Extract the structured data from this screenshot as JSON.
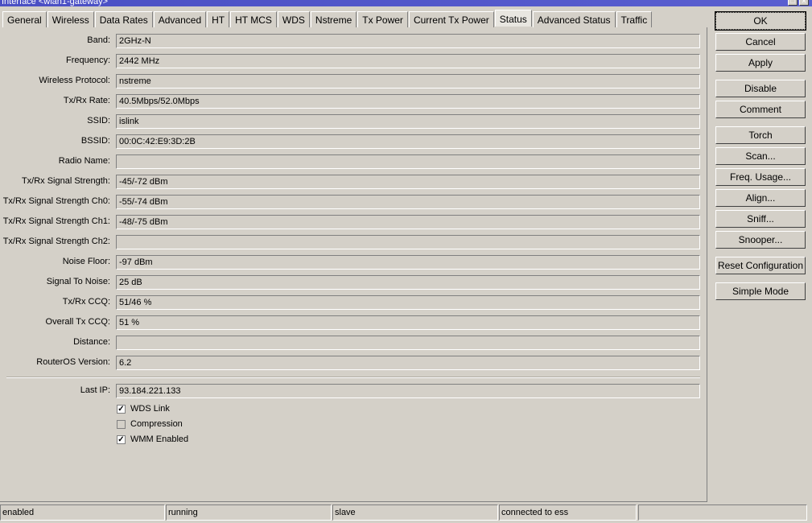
{
  "window": {
    "title": "Interface <wlan1-gateway>",
    "restore": "□",
    "close": "✕"
  },
  "tabs": [
    "General",
    "Wireless",
    "Data Rates",
    "Advanced",
    "HT",
    "HT MCS",
    "WDS",
    "Nstreme",
    "Tx Power",
    "Current Tx Power",
    "Status",
    "Advanced Status",
    "Traffic"
  ],
  "active_tab": "Status",
  "fields": [
    {
      "label": "Band:",
      "value": "2GHz-N"
    },
    {
      "label": "Frequency:",
      "value": "2442 MHz"
    },
    {
      "label": "Wireless Protocol:",
      "value": "nstreme"
    },
    {
      "label": "Tx/Rx Rate:",
      "value": "40.5Mbps/52.0Mbps"
    },
    {
      "label": "SSID:",
      "value": "islink"
    },
    {
      "label": "BSSID:",
      "value": "00:0C:42:E9:3D:2B"
    },
    {
      "label": "Radio Name:",
      "value": ""
    },
    {
      "label": "Tx/Rx Signal Strength:",
      "value": "-45/-72 dBm"
    },
    {
      "label": "Tx/Rx Signal Strength Ch0:",
      "value": "-55/-74 dBm"
    },
    {
      "label": "Tx/Rx Signal Strength Ch1:",
      "value": "-48/-75 dBm"
    },
    {
      "label": "Tx/Rx Signal Strength Ch2:",
      "value": ""
    },
    {
      "label": "Noise Floor:",
      "value": "-97 dBm"
    },
    {
      "label": "Signal To Noise:",
      "value": "25 dB"
    },
    {
      "label": "Tx/Rx CCQ:",
      "value": "51/46 %"
    },
    {
      "label": "Overall Tx CCQ:",
      "value": "51 %"
    },
    {
      "label": "Distance:",
      "value": ""
    },
    {
      "label": "RouterOS Version:",
      "value": "6.2"
    }
  ],
  "last_ip": {
    "label": "Last IP:",
    "value": "93.184.221.133"
  },
  "checkboxes": [
    {
      "label": "WDS Link",
      "checked": true
    },
    {
      "label": "Compression",
      "checked": false
    },
    {
      "label": "WMM Enabled",
      "checked": true
    }
  ],
  "buttons": [
    "OK",
    "Cancel",
    "Apply",
    "Disable",
    "Comment",
    "Torch",
    "Scan...",
    "Freq. Usage...",
    "Align...",
    "Sniff...",
    "Snooper...",
    "Reset Configuration",
    "Simple Mode"
  ],
  "statusbar": [
    "enabled",
    "running",
    "slave",
    "connected to ess",
    ""
  ]
}
